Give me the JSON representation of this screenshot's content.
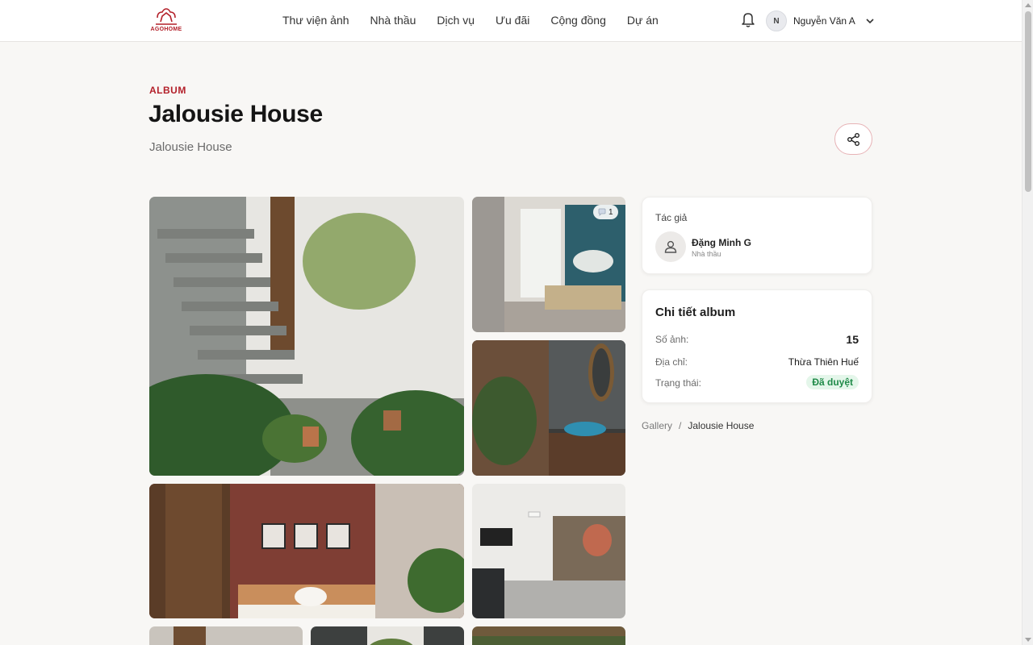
{
  "header": {
    "logo_text": "AGOHOME",
    "nav": [
      "Thư viện ảnh",
      "Nhà thầu",
      "Dịch vụ",
      "Ưu đãi",
      "Cộng đồng",
      "Dự án"
    ],
    "user_initial": "N",
    "user_name": "Nguyễn Văn A"
  },
  "album": {
    "eyebrow": "ALBUM",
    "title": "Jalousie House",
    "subtitle": "Jalousie House"
  },
  "photos": {
    "comment_count": "1"
  },
  "author": {
    "label": "Tác giả",
    "name": "Đặng Minh G",
    "role": "Nhà thầu"
  },
  "details": {
    "title": "Chi tiết album",
    "photo_count_label": "Số ảnh:",
    "photo_count": "15",
    "address_label": "Địa chỉ:",
    "address": "Thừa Thiên Huế",
    "status_label": "Trạng thái:",
    "status": "Đã duyệt"
  },
  "breadcrumb": {
    "root": "Gallery",
    "separator": "/",
    "current": "Jalousie House"
  },
  "colors": {
    "brand": "#b3202a",
    "status_bg": "#e4f6ea",
    "status_text": "#1f8a48"
  },
  "icons": [
    "bell-icon",
    "chevron-down-icon",
    "share-icon",
    "comment-icon",
    "user-icon"
  ]
}
